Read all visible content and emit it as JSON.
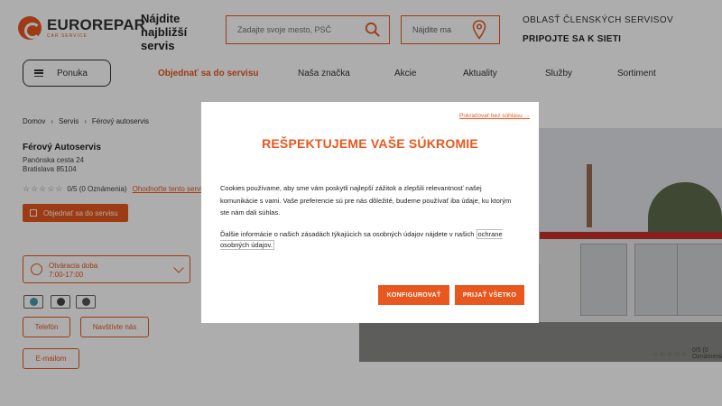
{
  "brand": {
    "name": "EUROREPAR",
    "tagline": "CAR SERVICE",
    "accent": "#e8571e"
  },
  "header": {
    "find_title": "Nájdite najbližší servis",
    "search_placeholder": "Zadajte svoje mesto, PSČ",
    "find_me": "Nájdite ma",
    "member_area": "OBLASŤ ČLENSKÝCH SERVISOV",
    "join_network": "PRIPOJTE SA K SIETI",
    "menu_label": "Ponuka"
  },
  "nav": [
    "Objednať sa do servisu",
    "Naša značka",
    "Akcie",
    "Aktuality",
    "Služby",
    "Sortiment"
  ],
  "breadcrumb": [
    "Domov",
    "Servis",
    "Férový autoservis"
  ],
  "shop": {
    "name": "Férový Autoservis",
    "street": "Panónska cesta 24",
    "city": "Bratislava 85104",
    "rating_text": "0/5 (0 Oznámenia)",
    "rate_link": "Ohodnoťte tento servis",
    "order_button": "Objednať sa do servisu",
    "hours_label": "Otváracia doba",
    "hours_time": "7:00-17:00",
    "phone_button": "Telefón",
    "visit_button": "Navštívte nás",
    "email_button": "E-mailom"
  },
  "photo_rating": "0/5 (0 Oznámenia)",
  "modal": {
    "skip_link": "Pokračovať bez súhlasu →",
    "title": "REŠPEKTUJEME VAŠE SÚKROMIE",
    "text1": "Cookies používame, aby sme vám poskytli najlepší zážitok a zlepšili relevantnosť našej komunikácie s vami. Vaše preferencie sú pre nás dôležité, budeme používať iba údaje, ku ktorým ste nám dali súhlas.",
    "text2": "Ďalšie informácie o našich zásadách týkajúcich sa osobných údajov nájdete v našich",
    "privacy_link": "ochrane osobných údajov.",
    "configure_button": "KONFIGUROVAŤ",
    "accept_button": "PRIJAŤ VŠETKO"
  }
}
